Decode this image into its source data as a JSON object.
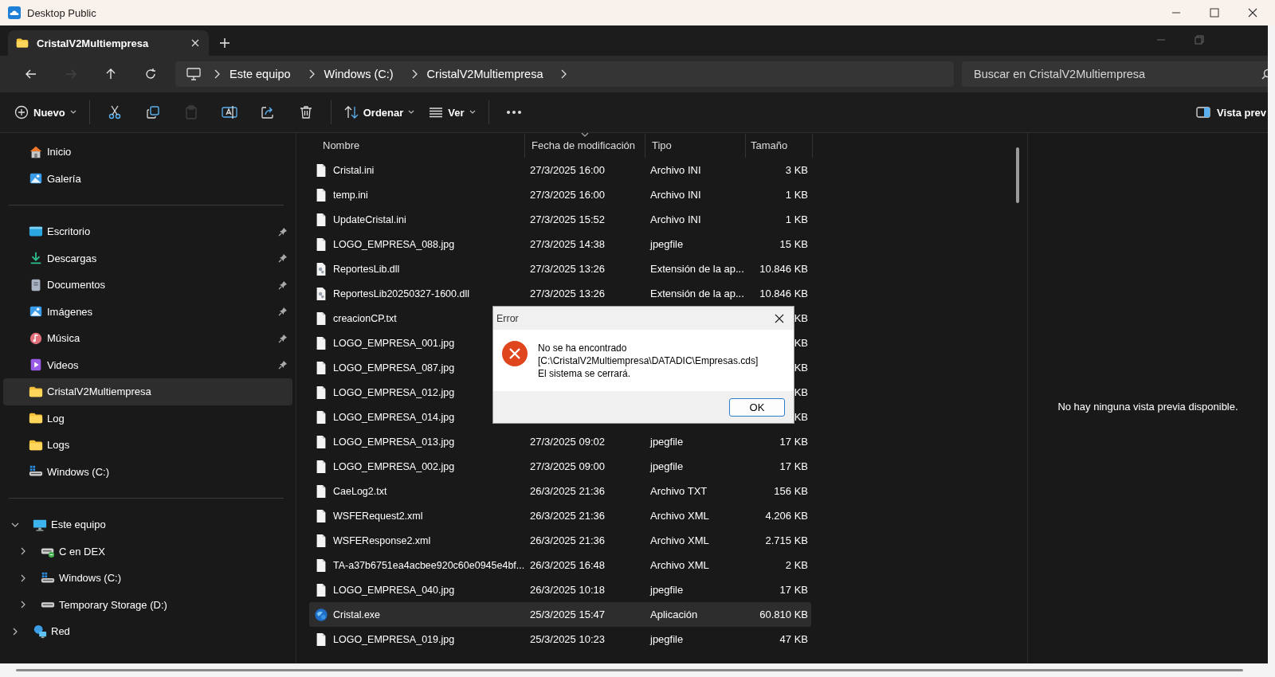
{
  "window": {
    "title": "Desktop Public"
  },
  "tabs": [
    {
      "label": "CristalV2Multiempresa",
      "selected": true
    }
  ],
  "nav": [
    {
      "kind": "back",
      "disabled": false
    },
    {
      "kind": "forward",
      "disabled": true
    },
    {
      "kind": "up",
      "disabled": false
    },
    {
      "kind": "refresh",
      "disabled": false
    }
  ],
  "breadcrumb": [
    "Este equipo",
    "Windows (C:)",
    "CristalV2Multiempresa"
  ],
  "search": {
    "placeholder": "Buscar en CristalV2Multiempresa"
  },
  "toolbar": [
    {
      "kind": "new",
      "label": "Nuevo",
      "disabled": false
    },
    {
      "kind": "cut",
      "disabled": false
    },
    {
      "kind": "copy",
      "disabled": false
    },
    {
      "kind": "paste",
      "disabled": true
    },
    {
      "kind": "rename",
      "disabled": false
    },
    {
      "kind": "share",
      "disabled": false
    },
    {
      "kind": "delete",
      "disabled": false
    },
    {
      "kind": "sort",
      "label": "Ordenar",
      "disabled": false
    },
    {
      "kind": "view",
      "label": "Ver",
      "disabled": false
    },
    {
      "kind": "more",
      "disabled": false
    }
  ],
  "preview_button": {
    "label": "Vista prev"
  },
  "sidebar": {
    "quick": [
      {
        "label": "Inicio",
        "kind": "home",
        "selected": false
      },
      {
        "label": "Galería",
        "kind": "gallery",
        "selected": false
      }
    ],
    "pinned": [
      {
        "label": "Escritorio",
        "kind": "desktop",
        "pinned": true,
        "selected": false
      },
      {
        "label": "Descargas",
        "kind": "download",
        "pinned": true,
        "selected": false
      },
      {
        "label": "Documentos",
        "kind": "documents",
        "pinned": true,
        "selected": false
      },
      {
        "label": "Imágenes",
        "kind": "gallery",
        "pinned": true,
        "selected": false
      },
      {
        "label": "Música",
        "kind": "music",
        "pinned": true,
        "selected": false
      },
      {
        "label": "Videos",
        "kind": "videos",
        "pinned": true,
        "selected": false
      },
      {
        "label": "CristalV2Multiempresa",
        "kind": "folder",
        "pinned": false,
        "selected": true
      },
      {
        "label": "Log",
        "kind": "folder",
        "pinned": false,
        "selected": false
      },
      {
        "label": "Logs",
        "kind": "folder",
        "pinned": false,
        "selected": false
      },
      {
        "label": "Windows (C:)",
        "kind": "windrive",
        "pinned": false,
        "selected": false
      }
    ],
    "tree": [
      {
        "label": "Este equipo",
        "kind": "pc",
        "expanded": true,
        "selected": false,
        "children": [
          {
            "label": "C en DEX",
            "kind": "netdrive",
            "expanded": false,
            "selected": false
          },
          {
            "label": "Windows (C:)",
            "kind": "windrive",
            "expanded": false,
            "selected": false
          },
          {
            "label": "Temporary Storage (D:)",
            "kind": "drive",
            "expanded": false,
            "selected": false
          }
        ]
      },
      {
        "label": "Red",
        "kind": "network",
        "expanded": false,
        "selected": false
      }
    ]
  },
  "table": {
    "columns": [
      {
        "label": "Nombre",
        "sorted": false
      },
      {
        "label": "Fecha de modificación",
        "sorted": true
      },
      {
        "label": "Tipo",
        "sorted": false
      },
      {
        "label": "Tamaño",
        "sorted": false
      }
    ],
    "rows": [
      {
        "name": "Cristal.ini",
        "kind": "file",
        "date": "27/3/2025 16:00",
        "type": "Archivo INI",
        "size": "3 KB",
        "selected": false
      },
      {
        "name": "temp.ini",
        "kind": "file",
        "date": "27/3/2025 16:00",
        "type": "Archivo INI",
        "size": "1 KB",
        "selected": false
      },
      {
        "name": "UpdateCristal.ini",
        "kind": "file",
        "date": "27/3/2025 15:52",
        "type": "Archivo INI",
        "size": "1 KB",
        "selected": false
      },
      {
        "name": "LOGO_EMPRESA_088.jpg",
        "kind": "file",
        "date": "27/3/2025 14:38",
        "type": "jpegfile",
        "size": "15 KB",
        "selected": false
      },
      {
        "name": "ReportesLib.dll",
        "kind": "dll",
        "date": "27/3/2025 13:26",
        "type": "Extensión de la ap...",
        "size": "10.846 KB",
        "selected": false
      },
      {
        "name": "ReportesLib20250327-1600.dll",
        "kind": "dll",
        "date": "27/3/2025 13:26",
        "type": "Extensión de la ap...",
        "size": "10.846 KB",
        "selected": false
      },
      {
        "name": "creacionCP.txt",
        "kind": "file",
        "size": "KB",
        "selected": false
      },
      {
        "name": "LOGO_EMPRESA_001.jpg",
        "kind": "file",
        "size": "KB",
        "selected": false
      },
      {
        "name": "LOGO_EMPRESA_087.jpg",
        "kind": "file",
        "size": "KB",
        "selected": false
      },
      {
        "name": "LOGO_EMPRESA_012.jpg",
        "kind": "file",
        "size": "KB",
        "selected": false
      },
      {
        "name": "LOGO_EMPRESA_014.jpg",
        "kind": "file",
        "size": "KB",
        "selected": false
      },
      {
        "name": "LOGO_EMPRESA_013.jpg",
        "kind": "file",
        "date": "27/3/2025 09:02",
        "type": "jpegfile",
        "size": "17 KB",
        "selected": false
      },
      {
        "name": "LOGO_EMPRESA_002.jpg",
        "kind": "file",
        "date": "27/3/2025 09:00",
        "type": "jpegfile",
        "size": "17 KB",
        "selected": false
      },
      {
        "name": "CaeLog2.txt",
        "kind": "file",
        "date": "26/3/2025 21:36",
        "type": "Archivo TXT",
        "size": "156 KB",
        "selected": false
      },
      {
        "name": "WSFERequest2.xml",
        "kind": "file",
        "date": "26/3/2025 21:36",
        "type": "Archivo XML",
        "size": "4.206 KB",
        "selected": false
      },
      {
        "name": "WSFEResponse2.xml",
        "kind": "file",
        "date": "26/3/2025 21:36",
        "type": "Archivo XML",
        "size": "2.715 KB",
        "selected": false
      },
      {
        "name": "TA-a37b6751ea4acbee920c60e0945e4bf...",
        "kind": "file",
        "date": "26/3/2025 16:48",
        "type": "Archivo XML",
        "size": "2 KB",
        "selected": false
      },
      {
        "name": "LOGO_EMPRESA_040.jpg",
        "kind": "file",
        "date": "26/3/2025 10:18",
        "type": "jpegfile",
        "size": "17 KB",
        "selected": false
      },
      {
        "name": "Cristal.exe",
        "kind": "exe",
        "date": "25/3/2025 15:47",
        "type": "Aplicación",
        "size": "60.810 KB",
        "selected": true
      },
      {
        "name": "LOGO_EMPRESA_019.jpg",
        "kind": "file",
        "date": "25/3/2025 10:23",
        "type": "jpegfile",
        "size": "47 KB",
        "selected": false
      }
    ]
  },
  "preview": {
    "message": "No hay ninguna vista previa disponible."
  },
  "dialog": {
    "title": "Error",
    "lines": [
      "No se ha encontrado",
      "[C:\\CristalV2Multiempresa\\DATADIC\\Empresas.cds]",
      "El sistema se cerrará."
    ],
    "button": "OK"
  }
}
